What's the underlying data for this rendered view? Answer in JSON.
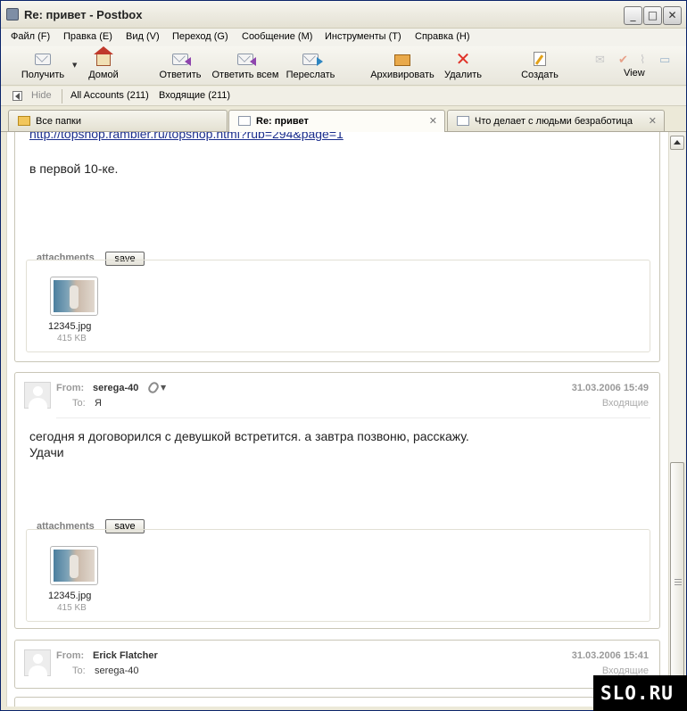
{
  "window": {
    "title": "Re: привет - Postbox"
  },
  "menu": [
    "Файл (F)",
    "Правка (E)",
    "Вид (V)",
    "Переход (G)",
    "Сообщение (M)",
    "Инструменты (T)",
    "Справка (H)"
  ],
  "toolbar": {
    "get": "Получить",
    "home": "Домой",
    "reply": "Ответить",
    "reply_all": "Ответить всем",
    "forward": "Переслать",
    "archive": "Архивировать",
    "delete": "Удалить",
    "compose": "Создать",
    "view": "View"
  },
  "accounts_bar": {
    "hide": "Hide",
    "all_accounts": "All Accounts (211)",
    "inbox": "Входящие (211)"
  },
  "tabs": [
    {
      "label": "Все папки"
    },
    {
      "label": "Re: привет"
    },
    {
      "label": "Что делает с людьми безработица"
    }
  ],
  "messages": [
    {
      "link": "http://topshop.rambler.ru/topshop.html?rub=294&page=1",
      "body": "в первой 10-ке.",
      "attachments_label": "attachments",
      "save_label": "save",
      "file": {
        "name": "12345.jpg",
        "size": "415 KB"
      }
    },
    {
      "from_label": "From:",
      "from": "serega-40",
      "to_label": "To:",
      "to": "Я",
      "date": "31.03.2006 15:49",
      "folder": "Входящие",
      "body": "сегодня я договорился с девушкой встретится. а завтра позвоню, расскажу.\nУдачи",
      "attachments_label": "attachments",
      "save_label": "save",
      "file": {
        "name": "12345.jpg",
        "size": "415 KB"
      }
    },
    {
      "from_label": "From:",
      "from": "Erick Flatcher",
      "to_label": "To:",
      "to": "serega-40",
      "date": "31.03.2006 15:41",
      "folder": "Входящие"
    }
  ],
  "watermark": "SLO.RU",
  "icons": [
    "app-icon",
    "minimize-icon",
    "maximize-icon",
    "close-icon",
    "envelope-icon",
    "home-icon",
    "reply-icon",
    "reply-all-icon",
    "forward-icon",
    "archive-icon",
    "delete-icon",
    "compose-icon",
    "folder-icon",
    "paperclip-icon",
    "avatar-icon"
  ]
}
